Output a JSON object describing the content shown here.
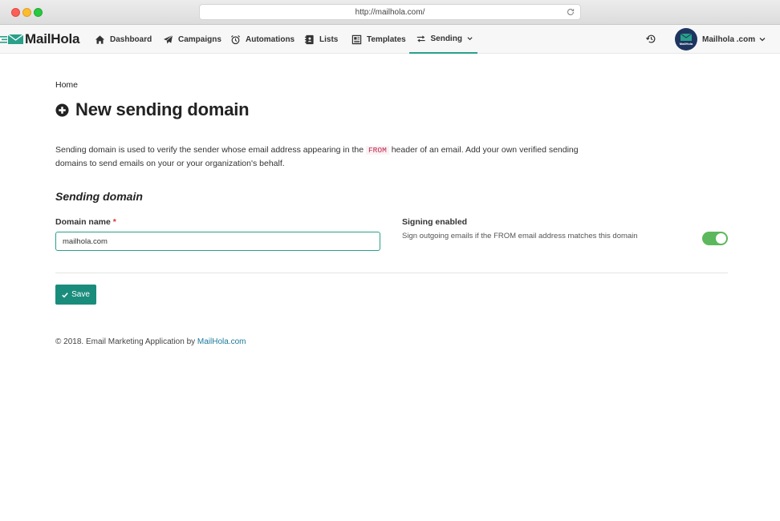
{
  "browser": {
    "url": "http://mailhola.com/"
  },
  "nav": {
    "brand": "MailHola",
    "items": [
      {
        "label": "Dashboard",
        "icon": "home-icon"
      },
      {
        "label": "Campaigns",
        "icon": "paper-plane-icon"
      },
      {
        "label": "Automations",
        "icon": "alarm-clock-icon"
      },
      {
        "label": "Lists",
        "icon": "address-book-icon"
      },
      {
        "label": "Templates",
        "icon": "template-icon"
      },
      {
        "label": "Sending",
        "icon": "exchange-arrows-icon",
        "active": true
      }
    ],
    "account": {
      "name": "Mailhola .com",
      "avatar_text": "MailHola"
    }
  },
  "page": {
    "breadcrumb": "Home",
    "title": "New sending domain",
    "description_before": "Sending domain is used to verify the sender whose email address appearing in the ",
    "description_code": "FROM",
    "description_after": " header of an email. Add your own verified sending domains to send emails on your or your organization's behalf.",
    "section_title": "Sending domain"
  },
  "form": {
    "domain_label": "Domain name",
    "domain_required_mark": "*",
    "domain_value": "mailhola.com",
    "signing_label": "Signing enabled",
    "signing_desc": "Sign outgoing emails if the FROM email address matches this domain",
    "signing_enabled": true,
    "save_label": "Save"
  },
  "footer": {
    "text": "© 2018. Email Marketing Application by ",
    "link": "MailHola.com"
  },
  "colors": {
    "accent": "#2aa08a",
    "save_button": "#1a8c7c",
    "toggle_on": "#5cb85c",
    "required": "#d9302c",
    "link": "#1a7a9c"
  }
}
